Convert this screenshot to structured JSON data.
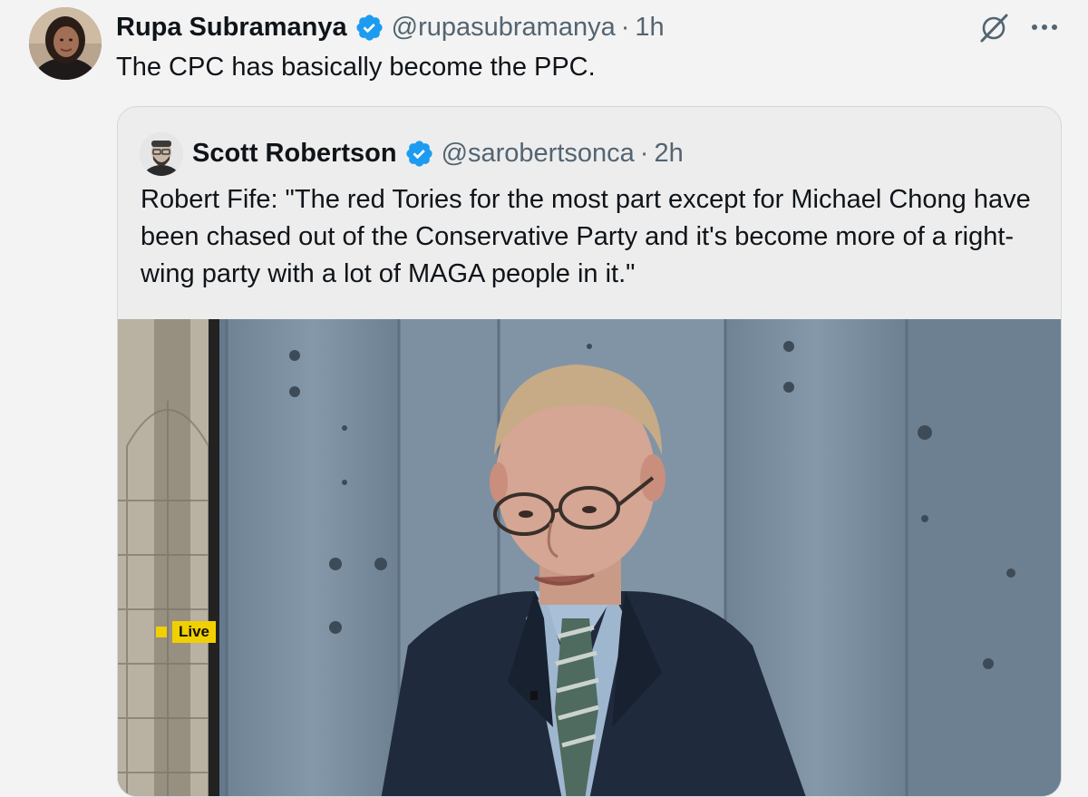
{
  "tweet": {
    "author_name": "Rupa Subramanya",
    "handle": "@rupasubramanya",
    "separator": "·",
    "time": "1h",
    "text": "The CPC has basically become the PPC.",
    "icons": [
      "avatar",
      "verified-badge-icon",
      "grok-icon",
      "more-options-icon"
    ]
  },
  "quote": {
    "author_name": "Scott Robertson",
    "handle": "@sarobertsonca",
    "separator": "·",
    "time": "2h",
    "text": "Robert Fife: \"The red Tories for the most part except for Michael Chong have been chased out of the Conservative Party and it's become more of a right-wing party with a lot of MAGA people in it.\"",
    "media": {
      "live_label": "Live"
    }
  },
  "colors": {
    "background": "#f3f3f3",
    "text": "#0f1419",
    "secondary_text": "#536471",
    "verified_blue": "#1d9bf0",
    "border": "#cfd9de",
    "live_yellow": "#f1d000"
  }
}
